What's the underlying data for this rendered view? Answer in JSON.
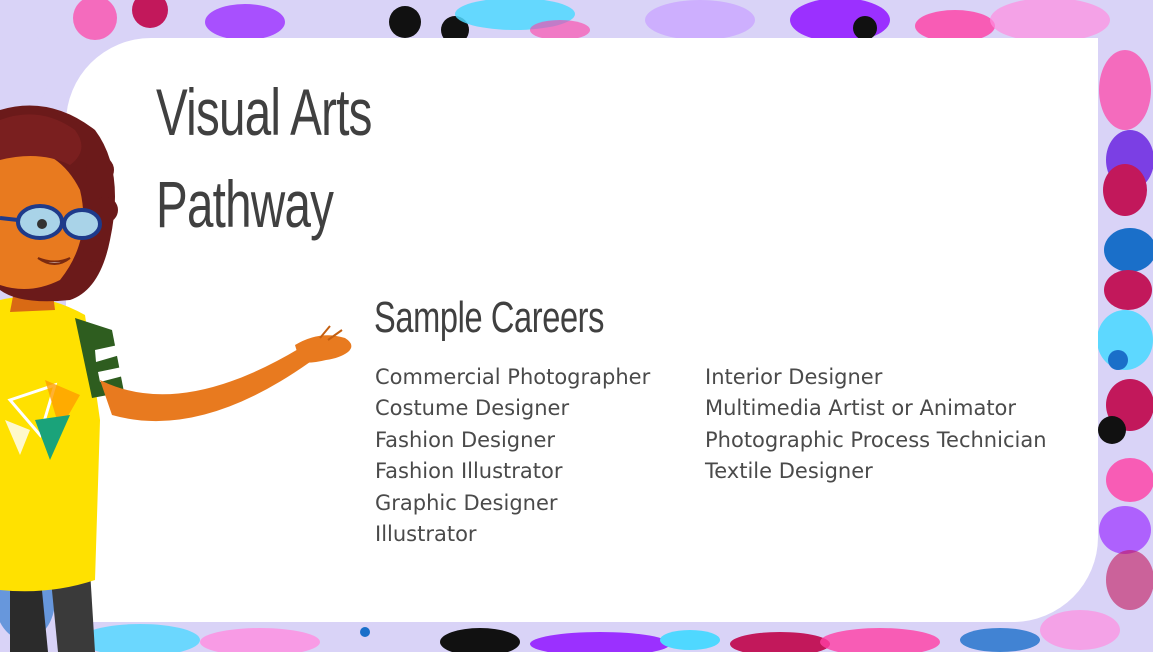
{
  "slide": {
    "title_lines": [
      "Visual Arts",
      "Pathway"
    ],
    "subtitle": "Sample Careers",
    "careers_col1": [
      "Commercial Photographer",
      "Costume Designer",
      "Fashion Designer",
      "Fashion Illustrator",
      "Graphic Designer",
      "Illustrator"
    ],
    "careers_col2": [
      "Interior Designer",
      "Multimedia Artist or Animator",
      "Photographic Process Technician",
      "Textile Designer"
    ]
  },
  "colors": {
    "background": "#d9d3f7",
    "card": "#ffffff",
    "title_text": "#404040",
    "body_text": "#4a4a4a",
    "splatter": [
      "#9b30ff",
      "#ff3fa4",
      "#4fd8ff",
      "#c2185b",
      "#111111",
      "#7b3fe4"
    ]
  },
  "icons": {
    "background_art": "paint-splatter",
    "character": "presenter-woman-illustration"
  }
}
